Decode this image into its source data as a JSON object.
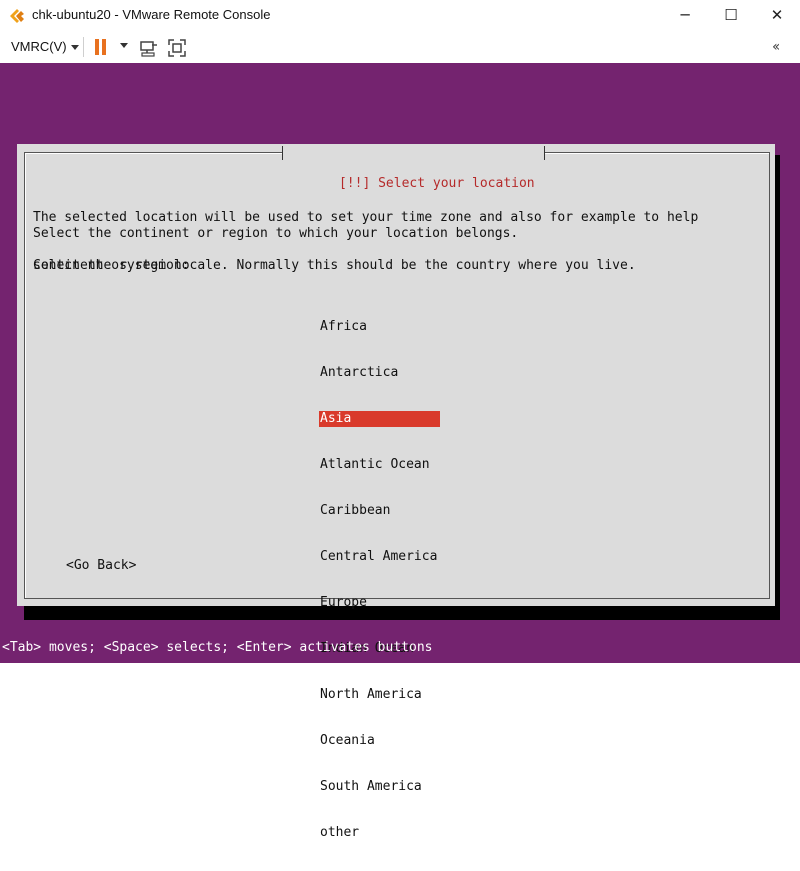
{
  "window": {
    "title": "chk-ubuntu20 - VMware Remote Console",
    "minimize_icon": "minimize-icon",
    "maximize_icon": "maximize-icon",
    "close_icon": "close-icon"
  },
  "toolbar": {
    "menu_label": "VMRC(V)",
    "pause_color": "#e8711f",
    "icons": [
      "pause-icon",
      "send-keys-icon",
      "fullscreen-icon",
      "collapse-icon"
    ]
  },
  "console": {
    "background": "#74236f",
    "dialog": {
      "title": "[!!] Select your location",
      "description_line1": "The selected location will be used to set your time zone and also for example to help",
      "description_line2": "select the system locale. Normally this should be the country where you live.",
      "prompt": "Select the continent or region to which your location belongs.",
      "list_label": "Continent or region:",
      "regions": [
        "Africa",
        "Antarctica",
        "Asia",
        "Atlantic Ocean",
        "Caribbean",
        "Central America",
        "Europe",
        "Indian Ocean",
        "North America",
        "Oceania",
        "South America",
        "other"
      ],
      "selected_region": "Asia",
      "selection_color": "#d93a2b",
      "go_back_label": "<Go Back>"
    },
    "status_hint": "<Tab> moves; <Space> selects; <Enter> activates buttons"
  }
}
